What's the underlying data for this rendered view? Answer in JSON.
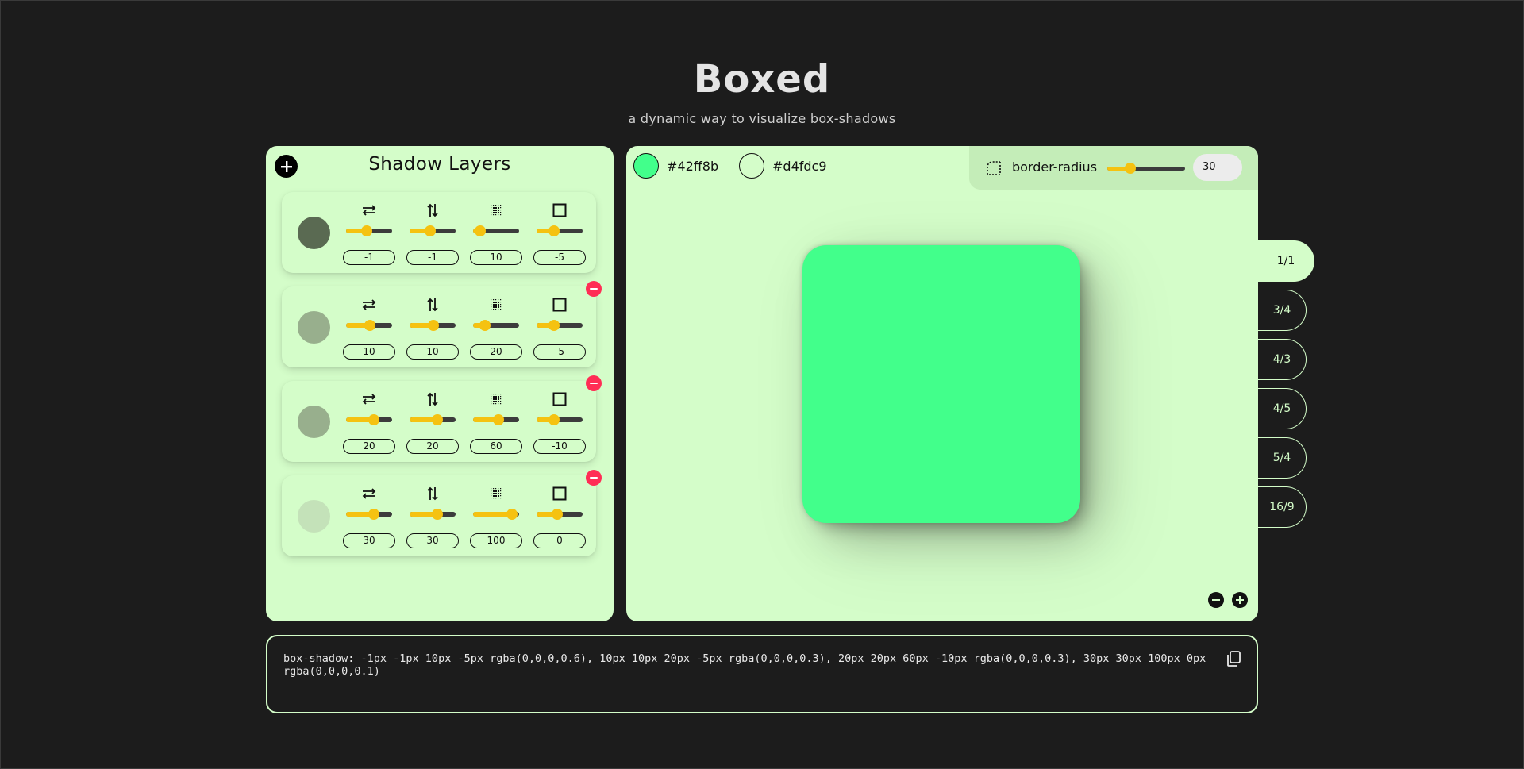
{
  "app": {
    "title": "Boxed",
    "subtitle": "a dynamic way to visualize box-shadows"
  },
  "layers_panel": {
    "title": "Shadow Layers",
    "add_icon": "plus-circle-icon",
    "control_icons": [
      "horizontal-offset-icon",
      "vertical-offset-icon",
      "blur-icon",
      "spread-icon"
    ],
    "layers": [
      {
        "color": "#5a6a52",
        "values": [
          "-1",
          "-1",
          "10",
          "-5"
        ],
        "levels": [
          0.45,
          0.45,
          0.15,
          0.38
        ],
        "removable": false
      },
      {
        "color": "#98af8d",
        "values": [
          "10",
          "10",
          "20",
          "-5"
        ],
        "levels": [
          0.52,
          0.52,
          0.25,
          0.38
        ],
        "removable": true
      },
      {
        "color": "#98af8d",
        "values": [
          "20",
          "20",
          "60",
          "-10"
        ],
        "levels": [
          0.6,
          0.6,
          0.55,
          0.38
        ],
        "removable": true
      },
      {
        "color": "#c4e2b9",
        "values": [
          "30",
          "30",
          "100",
          "0"
        ],
        "levels": [
          0.6,
          0.6,
          0.85,
          0.45
        ],
        "removable": true
      }
    ]
  },
  "preview": {
    "box_color": {
      "label": "#42ff8b",
      "value": "#42ff8b"
    },
    "background_color": {
      "label": "#d4fdc9",
      "value": "#d4fdc9"
    },
    "border_radius": {
      "label": "border-radius",
      "value": "30",
      "level": 0.3,
      "icon": "radius-corner-icon"
    },
    "zoom_out_icon": "minus-circle-icon",
    "zoom_in_icon": "plus-circle-icon",
    "aspect_ratios": [
      "1/1",
      "3/4",
      "4/3",
      "4/5",
      "5/4",
      "16/9"
    ],
    "active_ratio": "1/1"
  },
  "code": {
    "text": "box-shadow: -1px -1px 10px -5px rgba(0,0,0,0.6), 10px 10px 20px -5px rgba(0,0,0,0.3), 20px 20px 60px -10px rgba(0,0,0,0.3), 30px 30px 100px 0px rgba(0,0,0,0.1)",
    "copy_icon": "copy-icon"
  },
  "colors": {
    "page_bg": "#1c1c1c",
    "panel_bg": "#d4fdc9",
    "slider_accent": "#f5c211",
    "remove": "#ff2d55"
  }
}
